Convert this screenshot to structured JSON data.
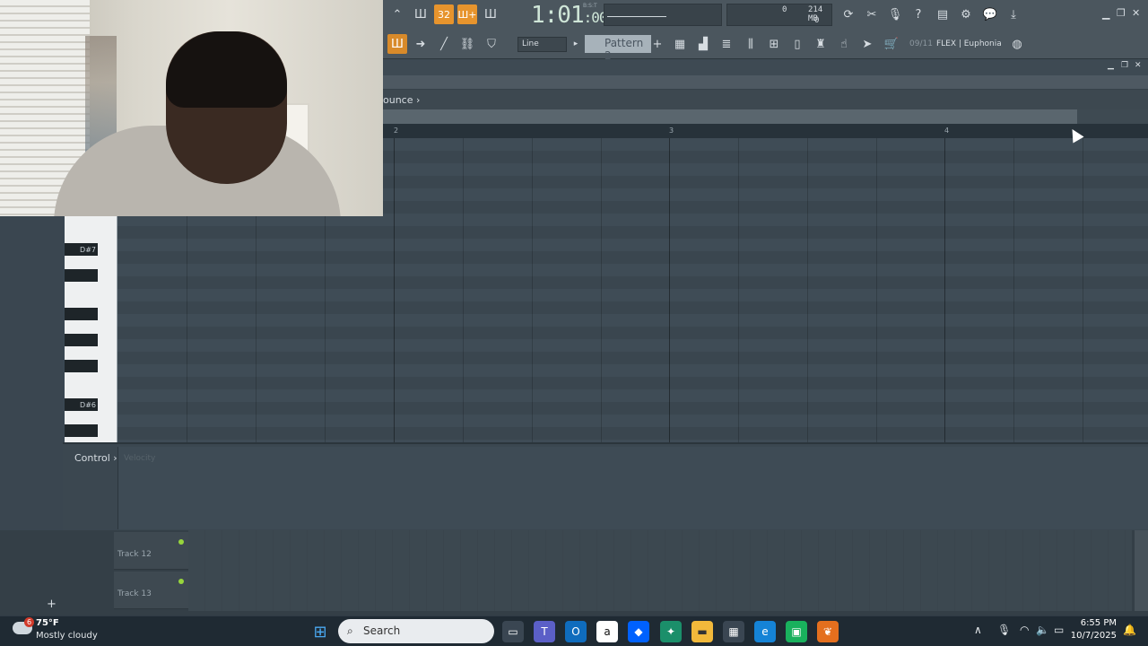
{
  "toolbar": {
    "time_main": "1:01",
    "time_sub": ":00",
    "time_mode": "B:S:T",
    "mem_top": "214 MB",
    "mem_left": "0",
    "mem_bottom": "0",
    "line_label": "Line",
    "pattern_label": "Pattern 2",
    "plugin_counter": "09/11",
    "plugin_name": "FLEX | Euphonia",
    "snap_button": "32",
    "pattern_song_button": "Ш+",
    "accent_color": "#e7942d"
  },
  "piano_roll": {
    "bounce_label": "ounce",
    "ruler": [
      "2",
      "3",
      "4"
    ],
    "keys": {
      "upper": "D#7",
      "lower": "D#6"
    },
    "control_label": "Control",
    "control_sub": "Velocity"
  },
  "playlist": {
    "tracks": [
      "Track 12",
      "Track 13"
    ],
    "add_label": "+"
  },
  "taskbar": {
    "weather_temp": "75°F",
    "weather_desc": "Mostly cloudy",
    "weather_badge": "6",
    "search_placeholder": "Search",
    "time": "6:55 PM",
    "date": "10/7/2025"
  }
}
